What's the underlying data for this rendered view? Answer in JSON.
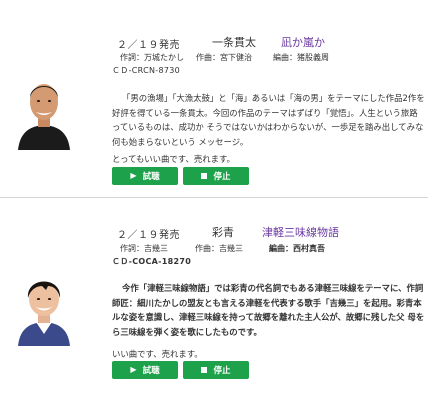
{
  "songs": [
    {
      "release": "２／１９発売",
      "artist": "一条貫太",
      "title": "凪か嵐か",
      "lyricist": "作詞：万城たかし",
      "composer": "作曲：宮下健治",
      "arranger": "編曲：猪股義周",
      "cd_no": "ＣＤ-CRCN-8730",
      "description": [
        "「男の漁場」「大漁太鼓」と「海」あるいは「海の男」をテーマにした作品2作を",
        "好評を得ている一条貫太。今回の作品のテーマはずばり「覚悟」。人生という旅路",
        "っているものは、成功か そうではないかはわからないが、一歩足を踏み出してみな",
        "何も始まらないという メッセージ。"
      ],
      "note": "とってもいい曲です、売れます。",
      "listen_label": "試聴",
      "stop_label": "停止"
    },
    {
      "release": "２／１９発売",
      "artist": "彩青",
      "title": "津軽三味線物語",
      "lyricist": "作詞：吉幾三",
      "composer": "作曲：吉幾三",
      "arranger": "編曲：西村真吾",
      "cd_no": "ＣＤ-COCA-18270",
      "description": [
        "今作「津軽三味線物語」では彩青の代名詞でもある津軽三味線をテーマに、作詞",
        "師匠：細川たかしの盟友とも言える津軽を代表する歌手「吉幾三」を起用。彩青本",
        "ルな姿を意識し、津軽三味線を持って故郷を離れた主人公が、故郷に残した父 母を",
        "ら三味線を弾く姿を歌にしたものです。"
      ],
      "note": "いい曲です、売れます。",
      "listen_label": "試聴",
      "stop_label": "停止"
    }
  ]
}
